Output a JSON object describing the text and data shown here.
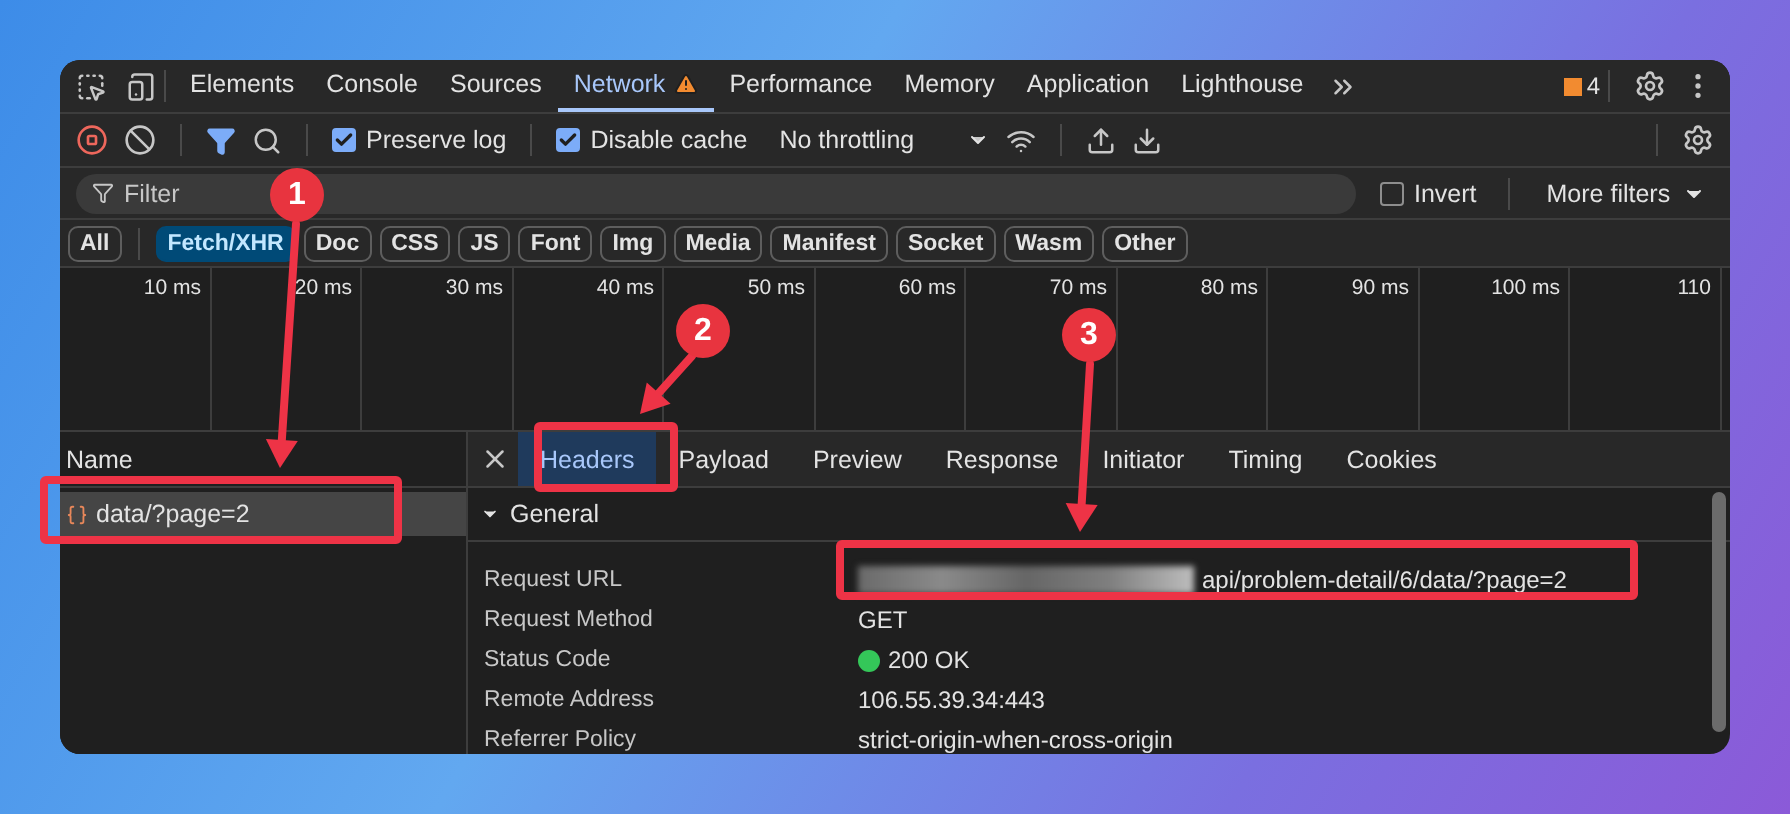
{
  "main_tabs": [
    {
      "label": "Elements",
      "selected": false,
      "warning": false
    },
    {
      "label": "Console",
      "selected": false,
      "warning": false
    },
    {
      "label": "Sources",
      "selected": false,
      "warning": false
    },
    {
      "label": "Network",
      "selected": true,
      "warning": true
    },
    {
      "label": "Performance",
      "selected": false,
      "warning": false
    },
    {
      "label": "Memory",
      "selected": false,
      "warning": false
    },
    {
      "label": "Application",
      "selected": false,
      "warning": false
    },
    {
      "label": "Lighthouse",
      "selected": false,
      "warning": false
    }
  ],
  "issues_count": "4",
  "toolbar": {
    "preserve_log": {
      "label": "Preserve log",
      "checked": true
    },
    "disable_cache": {
      "label": "Disable cache",
      "checked": true
    },
    "throttling": "No throttling"
  },
  "filter": {
    "placeholder": "Filter",
    "invert": {
      "label": "Invert",
      "checked": false
    },
    "more_filters": "More filters"
  },
  "type_filters": [
    {
      "label": "All",
      "selected": false
    },
    {
      "label": "Fetch/XHR",
      "selected": true
    },
    {
      "label": "Doc",
      "selected": false
    },
    {
      "label": "CSS",
      "selected": false
    },
    {
      "label": "JS",
      "selected": false
    },
    {
      "label": "Font",
      "selected": false
    },
    {
      "label": "Img",
      "selected": false
    },
    {
      "label": "Media",
      "selected": false
    },
    {
      "label": "Manifest",
      "selected": false
    },
    {
      "label": "Socket",
      "selected": false
    },
    {
      "label": "Wasm",
      "selected": false
    },
    {
      "label": "Other",
      "selected": false
    }
  ],
  "timeline": {
    "ticks": [
      "10 ms",
      "20 ms",
      "30 ms",
      "40 ms",
      "50 ms",
      "60 ms",
      "70 ms",
      "80 ms",
      "90 ms",
      "100 ms",
      "110"
    ]
  },
  "requests": {
    "column": "Name",
    "rows": [
      {
        "name": "data/?page=2",
        "selected": true
      }
    ]
  },
  "details": {
    "tabs": [
      {
        "label": "Headers",
        "selected": true
      },
      {
        "label": "Payload",
        "selected": false
      },
      {
        "label": "Preview",
        "selected": false
      },
      {
        "label": "Response",
        "selected": false
      },
      {
        "label": "Initiator",
        "selected": false
      },
      {
        "label": "Timing",
        "selected": false
      },
      {
        "label": "Cookies",
        "selected": false
      }
    ],
    "section": {
      "title": "General",
      "expanded": true,
      "rows": [
        {
          "label": "Request URL",
          "value": "api/problem-detail/6/data/?page=2",
          "kind": "redacted"
        },
        {
          "label": "Request Method",
          "value": "GET",
          "kind": "text"
        },
        {
          "label": "Status Code",
          "value": "200 OK",
          "kind": "status",
          "color": "#34c759"
        },
        {
          "label": "Remote Address",
          "value": "106.55.39.34:443",
          "kind": "text"
        },
        {
          "label": "Referrer Policy",
          "value": "strict-origin-when-cross-origin",
          "kind": "text"
        }
      ]
    }
  },
  "annotations": [
    {
      "number": "1"
    },
    {
      "number": "2"
    },
    {
      "number": "3"
    }
  ]
}
